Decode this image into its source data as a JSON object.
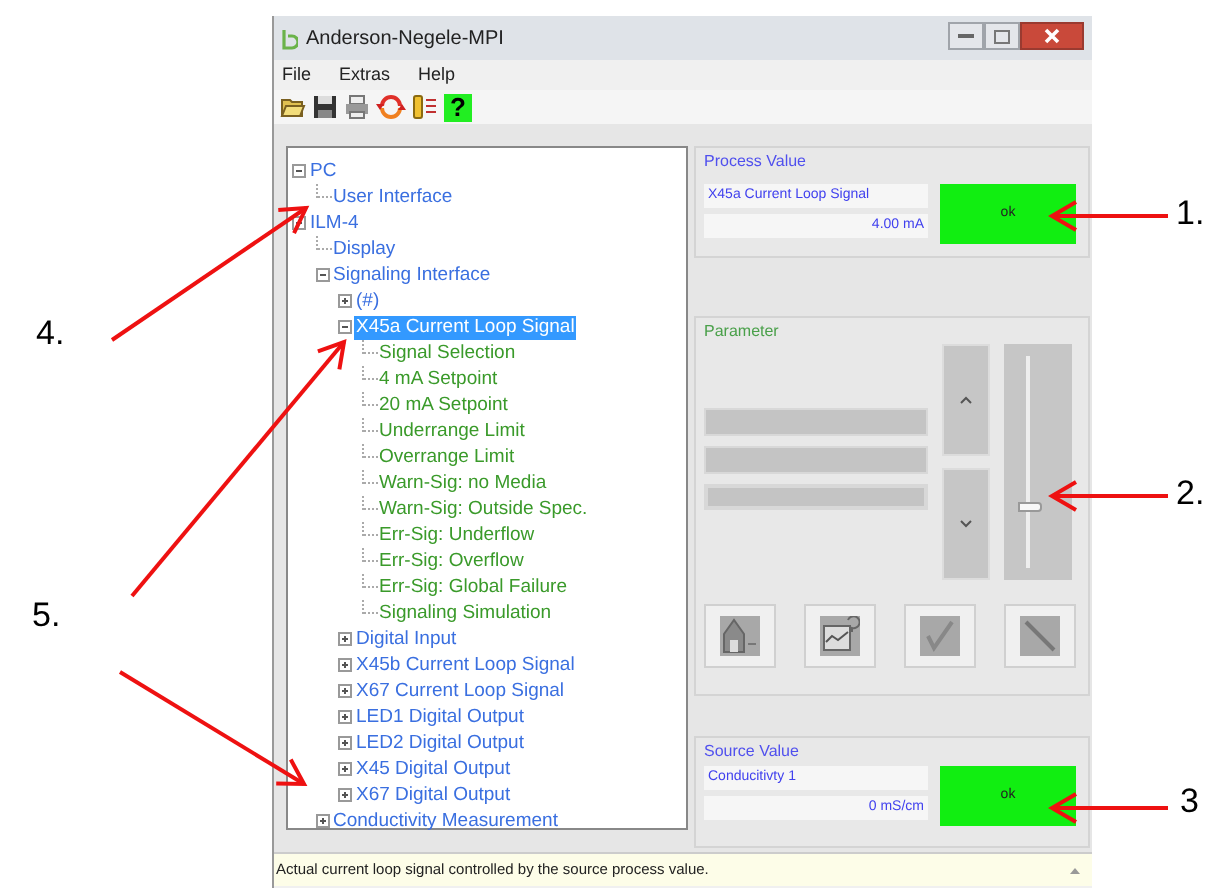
{
  "window": {
    "title": "Anderson-Negele-MPI"
  },
  "menu": [
    "File",
    "Extras",
    "Help"
  ],
  "toolbar": {
    "help_label": "?"
  },
  "tree": [
    {
      "label": "PC",
      "kind": "node",
      "selected": false,
      "expanded": true,
      "children": [
        {
          "label": "User Interface",
          "kind": "node",
          "selected": false
        }
      ]
    },
    {
      "label": "ILM-4",
      "kind": "node",
      "selected": false,
      "expanded": true,
      "children": [
        {
          "label": "Display",
          "kind": "node",
          "selected": false
        },
        {
          "label": "Signaling Interface",
          "kind": "node",
          "selected": false,
          "expanded": true,
          "children": [
            {
              "label": "(#)",
              "kind": "node",
              "selected": false,
              "expanded": false
            },
            {
              "label": "X45a Current Loop Signal",
              "kind": "node",
              "selected": true,
              "expanded": true,
              "children": [
                {
                  "label": "Signal Selection",
                  "kind": "parameter",
                  "selected": false
                },
                {
                  "label": "4 mA Setpoint",
                  "kind": "parameter",
                  "selected": false
                },
                {
                  "label": "20 mA Setpoint",
                  "kind": "parameter",
                  "selected": false
                },
                {
                  "label": "Underrange Limit",
                  "kind": "parameter",
                  "selected": false
                },
                {
                  "label": "Overrange Limit",
                  "kind": "parameter",
                  "selected": false
                },
                {
                  "label": "Warn-Sig: no Media",
                  "kind": "parameter",
                  "selected": false
                },
                {
                  "label": "Warn-Sig: Outside Spec.",
                  "kind": "parameter",
                  "selected": false
                },
                {
                  "label": "Err-Sig: Underflow",
                  "kind": "parameter",
                  "selected": false
                },
                {
                  "label": "Err-Sig: Overflow",
                  "kind": "parameter",
                  "selected": false
                },
                {
                  "label": "Err-Sig: Global Failure",
                  "kind": "parameter",
                  "selected": false
                },
                {
                  "label": "Signaling Simulation",
                  "kind": "parameter",
                  "selected": false
                }
              ]
            },
            {
              "label": "Digital Input",
              "kind": "node",
              "selected": false,
              "expanded": false
            },
            {
              "label": "X45b Current Loop Signal",
              "kind": "node",
              "selected": false,
              "expanded": false
            },
            {
              "label": "X67 Current Loop Signal",
              "kind": "node",
              "selected": false,
              "expanded": false
            },
            {
              "label": "LED1 Digital Output",
              "kind": "node",
              "selected": false,
              "expanded": false
            },
            {
              "label": "LED2 Digital Output",
              "kind": "node",
              "selected": false,
              "expanded": false
            },
            {
              "label": "X45 Digital Output",
              "kind": "node",
              "selected": false,
              "expanded": false
            },
            {
              "label": "X67 Digital Output",
              "kind": "node",
              "selected": false,
              "expanded": false
            }
          ]
        },
        {
          "label": "Conductivity Measurement",
          "kind": "node",
          "selected": false,
          "expanded": false
        }
      ]
    }
  ],
  "process_value": {
    "title": "Process Value",
    "name": "X45a Current Loop Signal",
    "value": "4.00 mA",
    "status": "ok"
  },
  "parameter": {
    "title": "Parameter",
    "slider": {
      "level": 0.28
    }
  },
  "source_value": {
    "title": "Source Value",
    "name": "Conducitivty 1",
    "value": "0 mS/cm",
    "status": "ok"
  },
  "status_bar": "Actual current loop signal controlled by the source process value.",
  "annotations": [
    {
      "label": "1."
    },
    {
      "label": "2."
    },
    {
      "label": "3"
    },
    {
      "label": "4."
    },
    {
      "label": "5."
    }
  ]
}
